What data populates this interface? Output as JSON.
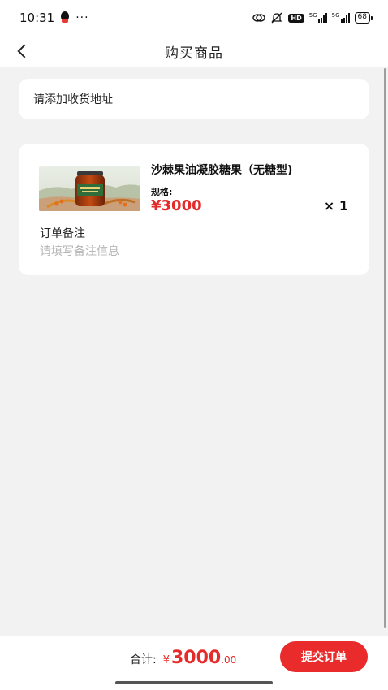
{
  "status_bar": {
    "time": "10:31",
    "dots": "···",
    "hd_badge": "HD",
    "signal_label_1": "5G",
    "signal_label_2": "5G",
    "battery": "68"
  },
  "nav": {
    "title": "购买商品"
  },
  "address": {
    "prompt": "请添加收货地址"
  },
  "product": {
    "name": "沙棘果油凝胶糖果（无糖型)",
    "spec_label": "规格:",
    "price": "¥3000",
    "quantity": "× 1",
    "image_icon": "product-jar-image"
  },
  "remark": {
    "label": "订单备注",
    "placeholder": "请填写备注信息",
    "value": ""
  },
  "footer": {
    "total_label": "合计:",
    "currency": "¥",
    "total_integer": "3000",
    "total_decimal": ".00",
    "submit_label": "提交订单"
  },
  "colors": {
    "accent": "#ea2b2b",
    "price": "#e52a2a",
    "background": "#f2f2f2"
  }
}
